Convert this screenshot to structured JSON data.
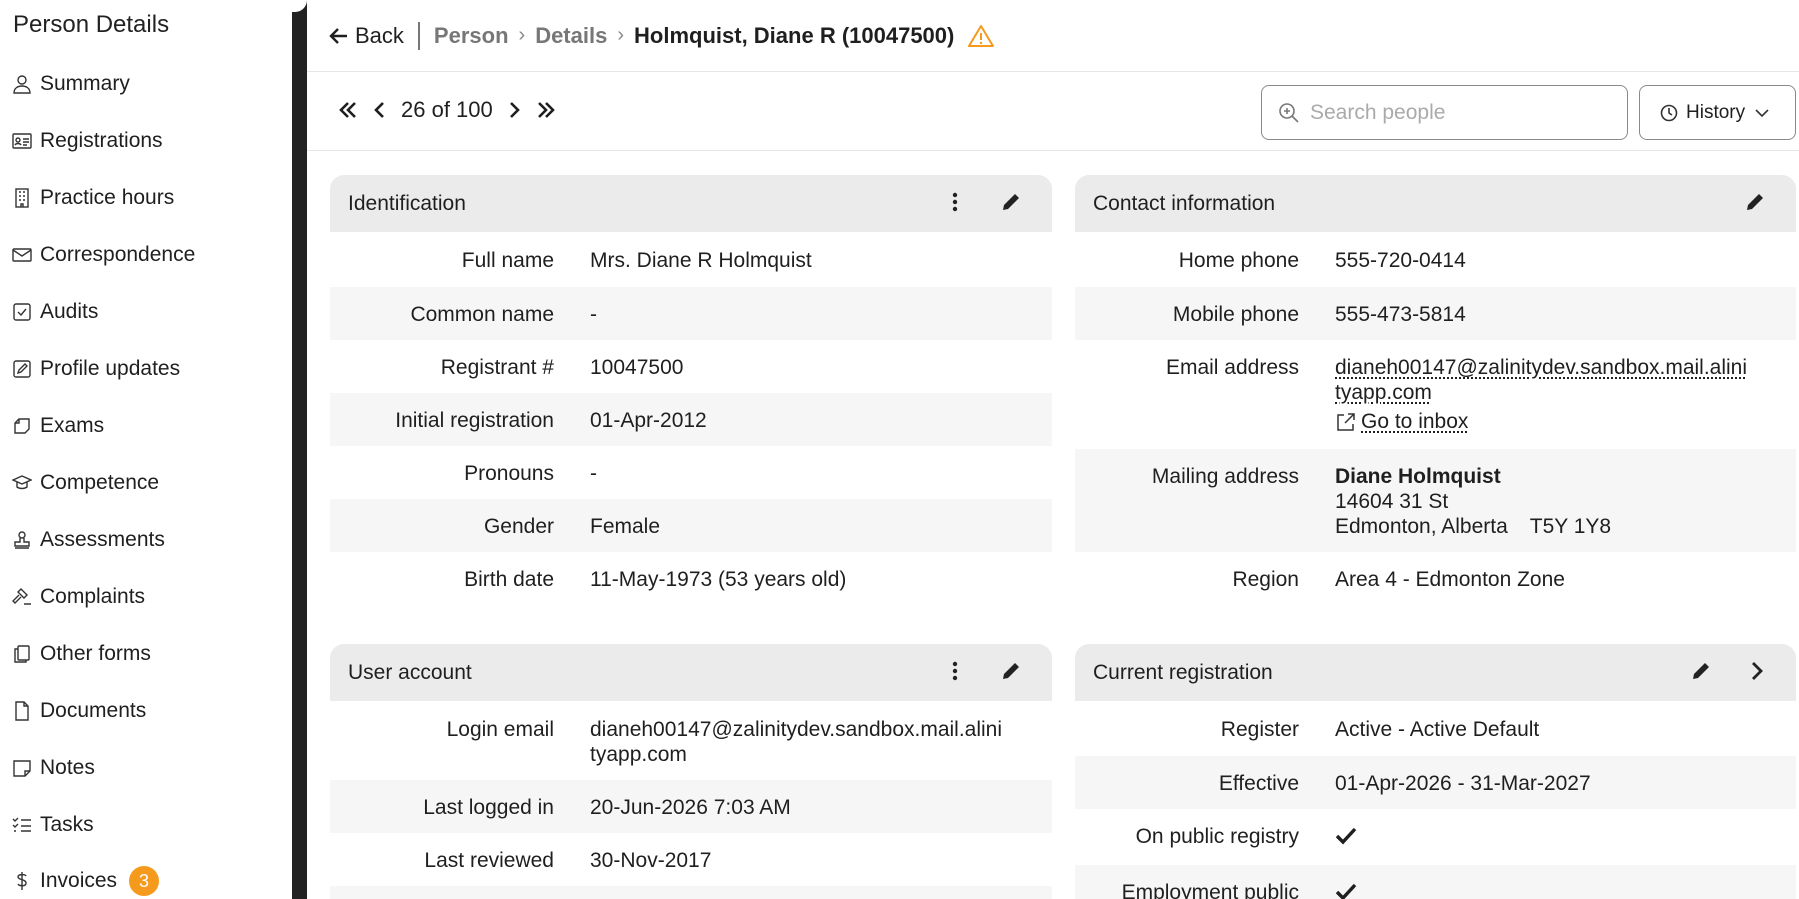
{
  "sidebar": {
    "title": "Person Details",
    "items": [
      {
        "label": "Summary",
        "icon": "person-icon"
      },
      {
        "label": "Registrations",
        "icon": "id-card-icon"
      },
      {
        "label": "Practice hours",
        "icon": "building-icon"
      },
      {
        "label": "Correspondence",
        "icon": "envelope-icon"
      },
      {
        "label": "Audits",
        "icon": "checkbox-icon"
      },
      {
        "label": "Profile updates",
        "icon": "edit-square-icon"
      },
      {
        "label": "Exams",
        "icon": "exam-icon"
      },
      {
        "label": "Competence",
        "icon": "graduation-cap-icon"
      },
      {
        "label": "Assessments",
        "icon": "stamp-icon"
      },
      {
        "label": "Complaints",
        "icon": "gavel-icon"
      },
      {
        "label": "Other forms",
        "icon": "copy-icon"
      },
      {
        "label": "Documents",
        "icon": "document-icon"
      },
      {
        "label": "Notes",
        "icon": "note-icon"
      },
      {
        "label": "Tasks",
        "icon": "list-check-icon"
      },
      {
        "label": "Invoices",
        "icon": "dollar-icon",
        "badge": "3"
      }
    ]
  },
  "header": {
    "back_label": "Back",
    "breadcrumb": [
      "Person",
      "Details"
    ],
    "current": "Holmquist, Diane R (10047500)",
    "warning_color": "#f59a1c"
  },
  "pager": {
    "text": "26 of 100"
  },
  "search": {
    "placeholder": "Search people"
  },
  "history": {
    "label": "History"
  },
  "identification": {
    "title": "Identification",
    "rows": [
      {
        "label": "Full name",
        "value": "Mrs. Diane R Holmquist"
      },
      {
        "label": "Common name",
        "value": "-"
      },
      {
        "label": "Registrant #",
        "value": "10047500"
      },
      {
        "label": "Initial registration",
        "value": "01-Apr-2012"
      },
      {
        "label": "Pronouns",
        "value": "-"
      },
      {
        "label": "Gender",
        "value": "Female"
      },
      {
        "label": "Birth date",
        "value": "11-May-1973 (53 years old)"
      }
    ]
  },
  "user_account": {
    "title": "User account",
    "rows": [
      {
        "label": "Login email",
        "value_line1": "dianeh00147@zalinitydev.sandbox.mail.alini",
        "value_line2": "tyapp.com"
      },
      {
        "label": "Last logged in",
        "value": "20-Jun-2026 7:03 AM"
      },
      {
        "label": "Last reviewed",
        "value": "30-Nov-2017"
      }
    ]
  },
  "contact": {
    "title": "Contact information",
    "home_phone_label": "Home phone",
    "home_phone": "555-720-0414",
    "mobile_phone_label": "Mobile phone",
    "mobile_phone": "555-473-5814",
    "email_label": "Email address",
    "email_line1": "dianeh00147@zalinitydev.sandbox.mail.alini",
    "email_line2": "tyapp.com",
    "inbox_label": "Go to inbox",
    "mailing_label": "Mailing address",
    "mailing_name": "Diane Holmquist",
    "mailing_street": "14604 31 St",
    "mailing_city": "Edmonton, Alberta",
    "mailing_postal": "T5Y 1Y8",
    "region_label": "Region",
    "region": "Area 4 - Edmonton Zone"
  },
  "current_registration": {
    "title": "Current registration",
    "register_label": "Register",
    "register": "Active - Active Default",
    "effective_label": "Effective",
    "effective": "01-Apr-2026 - 31-Mar-2027",
    "public_label": "On public registry",
    "employment_label": "Employment public"
  }
}
